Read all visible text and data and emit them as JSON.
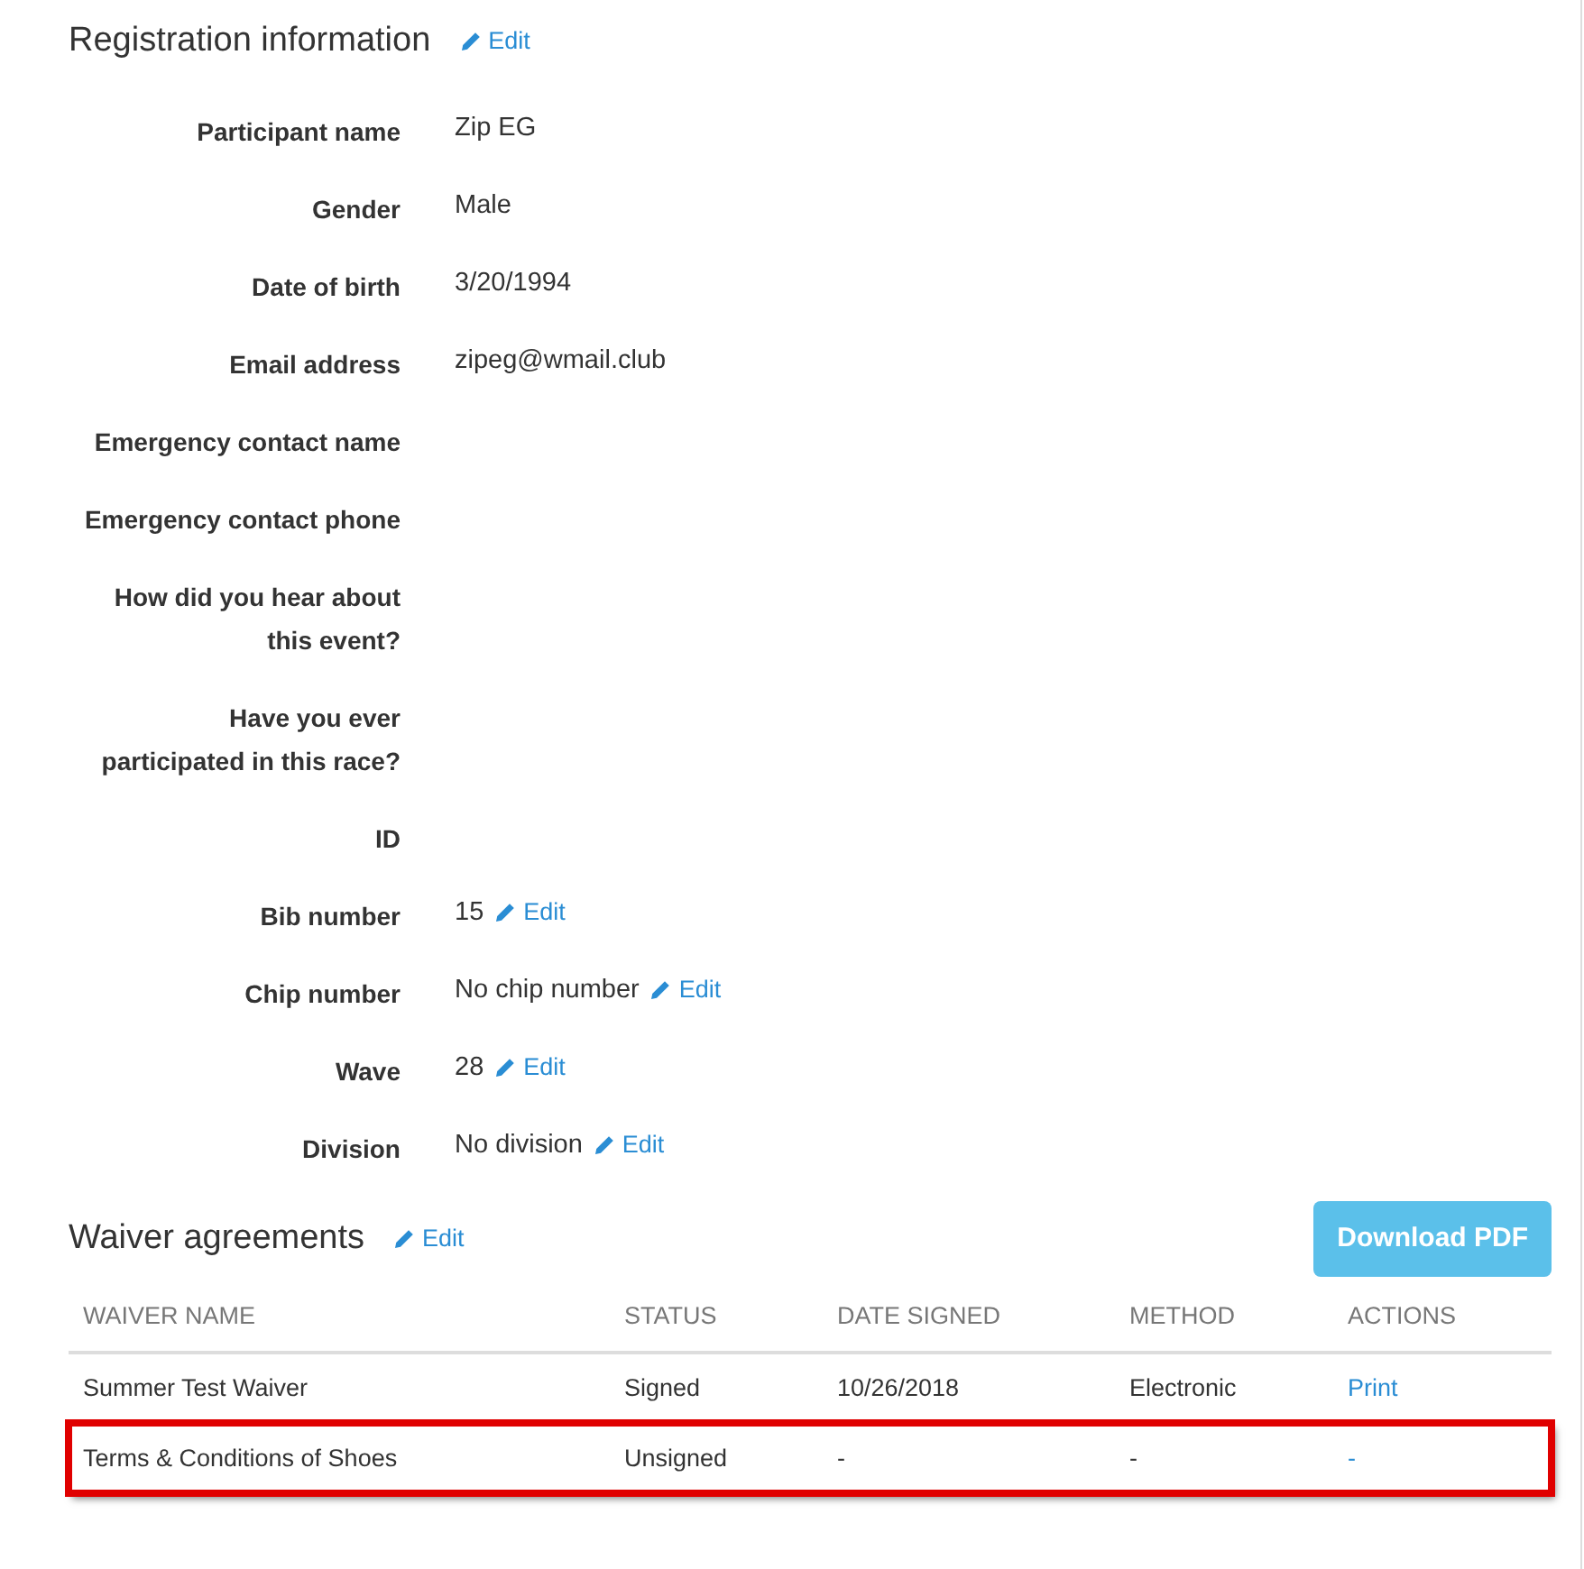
{
  "registration": {
    "title": "Registration information",
    "edit": "Edit",
    "fields": [
      {
        "label": "Participant name",
        "value": "Zip EG"
      },
      {
        "label": "Gender",
        "value": "Male"
      },
      {
        "label": "Date of birth",
        "value": "3/20/1994"
      },
      {
        "label": "Email address",
        "value": "zipeg@wmail.club"
      },
      {
        "label": "Emergency contact name"
      },
      {
        "label": "Emergency contact phone"
      },
      {
        "label": "How did you hear about this event?"
      },
      {
        "label": "Have you ever participated in this race?"
      },
      {
        "label": "ID"
      },
      {
        "label": "Bib number",
        "value": "15",
        "edit": "Edit"
      },
      {
        "label": "Chip number",
        "value": "No chip number",
        "edit": "Edit"
      },
      {
        "label": "Wave",
        "value": "28",
        "edit": "Edit"
      },
      {
        "label": "Division",
        "value": "No division",
        "edit": "Edit"
      }
    ]
  },
  "waivers": {
    "title": "Waiver agreements",
    "edit": "Edit",
    "download_button": "Download PDF",
    "columns": [
      "WAIVER NAME",
      "STATUS",
      "DATE SIGNED",
      "METHOD",
      "ACTIONS"
    ],
    "rows": [
      {
        "cells": [
          "Summer Test Waiver",
          "Signed",
          "10/26/2018",
          "Electronic",
          "Print"
        ],
        "highlighted": false
      },
      {
        "cells": [
          "Terms & Conditions of Shoes",
          "Unsigned",
          "-",
          "-",
          "-"
        ],
        "highlighted": true
      }
    ]
  }
}
